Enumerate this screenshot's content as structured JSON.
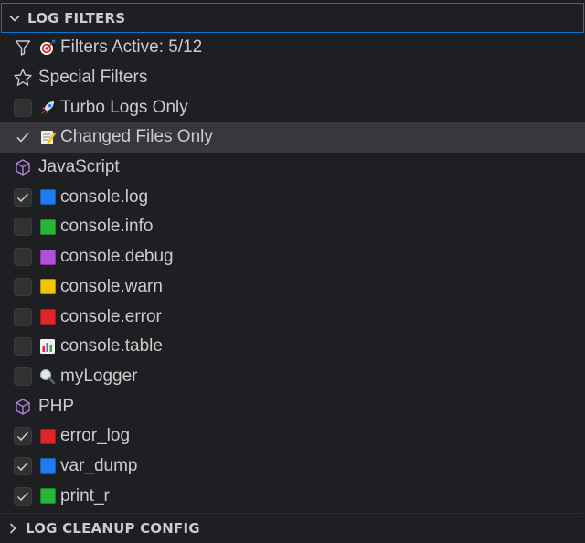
{
  "header": {
    "title": "LOG FILTERS"
  },
  "footer": {
    "title": "LOG CLEANUP CONFIG"
  },
  "summary": {
    "label": "Filters Active: 5/12",
    "icon": "filter-icon",
    "emoji": "target-emoji"
  },
  "special": {
    "label": "Special Filters",
    "icon": "star-icon",
    "items": [
      {
        "label": "Turbo Logs Only",
        "checked": false,
        "emoji": "rocket-emoji"
      },
      {
        "label": "Changed Files Only",
        "checked": true,
        "emoji": "memo-emoji",
        "selected": true
      }
    ]
  },
  "javascript": {
    "label": "JavaScript",
    "icon": "cube-icon",
    "items": [
      {
        "label": "console.log",
        "checked": true,
        "color": "#1f7bf2"
      },
      {
        "label": "console.info",
        "checked": false,
        "color": "#29b53a"
      },
      {
        "label": "console.debug",
        "checked": false,
        "color": "#b14fd8"
      },
      {
        "label": "console.warn",
        "checked": false,
        "color": "#f5c400"
      },
      {
        "label": "console.error",
        "checked": false,
        "color": "#e0262b"
      },
      {
        "label": "console.table",
        "checked": false,
        "emoji": "bar-chart-emoji"
      },
      {
        "label": "myLogger",
        "checked": false,
        "emoji": "magnifier-emoji"
      }
    ]
  },
  "php": {
    "label": "PHP",
    "icon": "cube-icon",
    "items": [
      {
        "label": "error_log",
        "checked": true,
        "color": "#e0262b"
      },
      {
        "label": "var_dump",
        "checked": true,
        "color": "#1f7bf2"
      },
      {
        "label": "print_r",
        "checked": true,
        "color": "#29b53a"
      }
    ]
  },
  "colors": {
    "background": "#1e1f22",
    "focus_border": "#0078d4",
    "selection": "#37373d",
    "cube": "#b180d7"
  }
}
